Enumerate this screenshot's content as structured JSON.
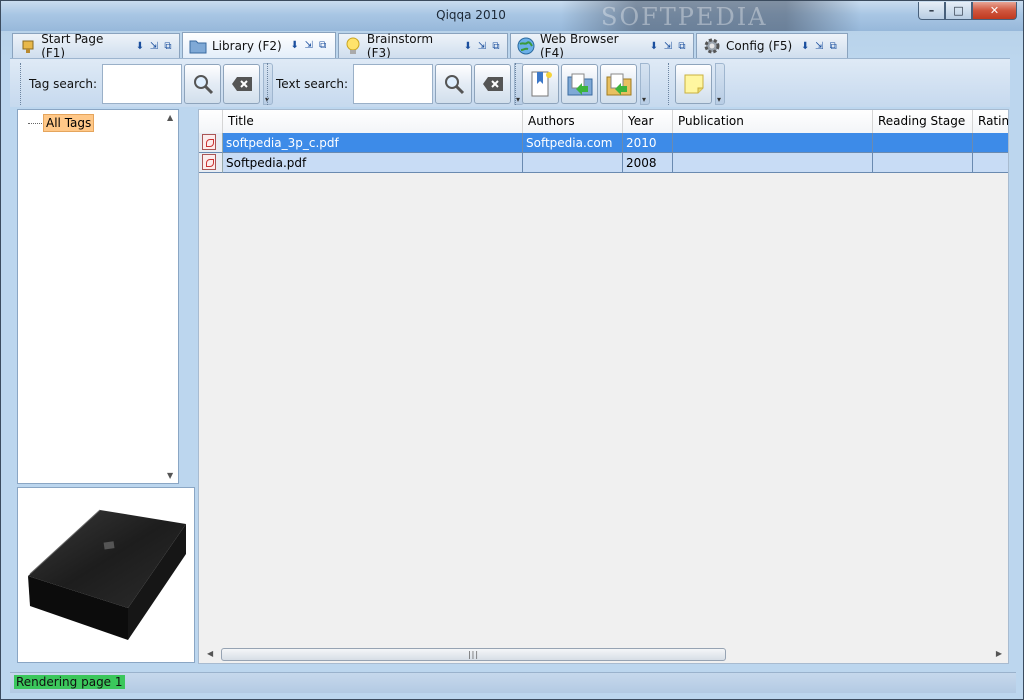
{
  "window": {
    "title": "Qiqqa 2010",
    "watermark": "SOFTPEDIA"
  },
  "caption": {
    "minimize": "–",
    "maximize": "□",
    "close": "✕"
  },
  "tabs": [
    {
      "label": "Start Page (F1)",
      "icon": "start-page-icon"
    },
    {
      "label": "Library (F2)",
      "icon": "folder-icon",
      "active": true
    },
    {
      "label": "Brainstorm (F3)",
      "icon": "lightbulb-icon"
    },
    {
      "label": "Web Browser (F4)",
      "icon": "globe-icon"
    },
    {
      "label": "Config (F5)",
      "icon": "gear-icon"
    }
  ],
  "toolbar": {
    "tag_search_label": "Tag search:",
    "tag_search_value": "",
    "text_search_label": "Text search:",
    "text_search_value": ""
  },
  "tree": {
    "root_label": "All Tags"
  },
  "grid": {
    "columns": [
      "",
      "Title",
      "Authors",
      "Year",
      "Publication",
      "Reading Stage",
      "Rating"
    ],
    "rows": [
      {
        "title": "softpedia_3p_c.pdf",
        "authors": "Softpedia.com",
        "year": "2010",
        "publication": "",
        "reading_stage": "",
        "rating": ""
      },
      {
        "title": "Softpedia.pdf",
        "authors": "",
        "year": "2008",
        "publication": "",
        "reading_stage": "",
        "rating": ""
      }
    ]
  },
  "status": {
    "text": "Rendering page 1"
  },
  "colors": {
    "selection": "#3d8be8",
    "alt_row": "#c8dcf5",
    "tag_highlight": "#ffc888",
    "status_highlight": "#3bc75c"
  }
}
